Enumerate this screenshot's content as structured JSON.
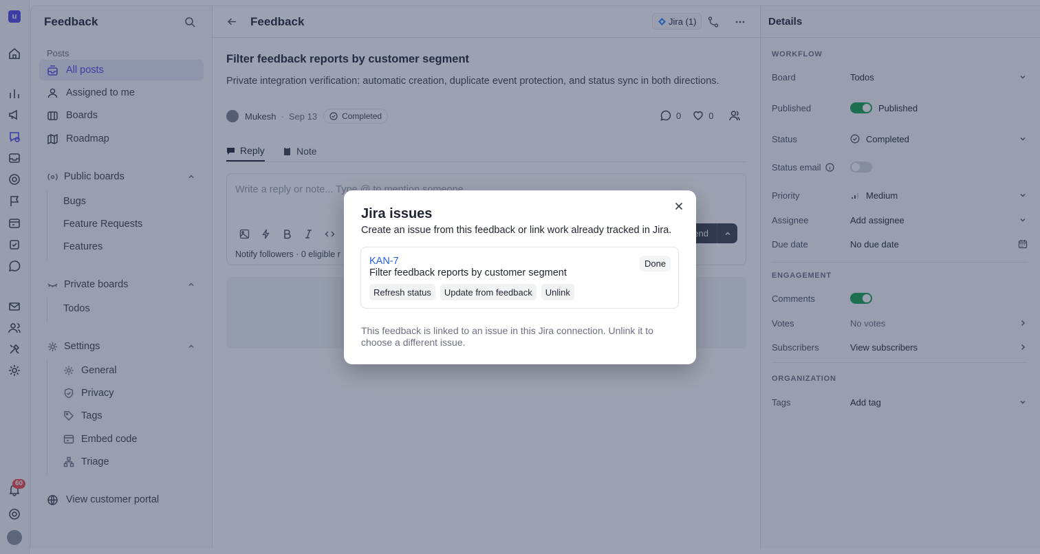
{
  "rail": {
    "logo_letter": "u",
    "notification_count": "60"
  },
  "sidebar": {
    "title": "Feedback",
    "posts_label": "Posts",
    "nav": [
      {
        "label": "All posts"
      },
      {
        "label": "Assigned to me"
      },
      {
        "label": "Boards"
      },
      {
        "label": "Roadmap"
      }
    ],
    "public_boards": {
      "label": "Public boards",
      "items": [
        "Bugs",
        "Feature Requests",
        "Features"
      ]
    },
    "private_boards": {
      "label": "Private boards",
      "items": [
        "Todos"
      ]
    },
    "settings": {
      "label": "Settings",
      "items": [
        "General",
        "Privacy",
        "Tags",
        "Embed code",
        "Triage"
      ]
    },
    "portal_link": "View customer portal"
  },
  "main": {
    "title": "Feedback",
    "jira_chip": "Jira (1)",
    "post_title": "Filter feedback reports by customer segment",
    "post_description": "Private integration verification: automatic creation, duplicate event protection, and status sync in both directions.",
    "author": "Mukesh",
    "date": "Sep 13",
    "status": "Completed",
    "comment_count": "0",
    "vote_count": "0",
    "tabs": [
      {
        "label": "Reply"
      },
      {
        "label": "Note"
      }
    ],
    "editor_placeholder": "Write a reply or note... Type @ to mention someone",
    "notify_text": "Notify followers · 0 eligible r",
    "send_label": "end"
  },
  "details": {
    "title": "Details",
    "workflow_label": "WORKFLOW",
    "engagement_label": "ENGAGEMENT",
    "organization_label": "ORGANIZATION",
    "board": {
      "label": "Board",
      "value": "Todos"
    },
    "published": {
      "label": "Published",
      "value": "Published"
    },
    "status": {
      "label": "Status",
      "value": "Completed"
    },
    "status_email": {
      "label": "Status email"
    },
    "priority": {
      "label": "Priority",
      "value": "Medium"
    },
    "assignee": {
      "label": "Assignee",
      "value": "Add assignee"
    },
    "due_date": {
      "label": "Due date",
      "value": "No due date"
    },
    "comments": {
      "label": "Comments"
    },
    "votes": {
      "label": "Votes",
      "value": "No votes"
    },
    "subscribers": {
      "label": "Subscribers",
      "value": "View subscribers"
    },
    "tags": {
      "label": "Tags",
      "value": "Add tag"
    }
  },
  "modal": {
    "title": "Jira issues",
    "subtitle": "Create an issue from this feedback or link work already tracked in Jira.",
    "issue": {
      "key": "KAN-7",
      "title": "Filter feedback reports by customer segment",
      "status": "Done",
      "actions": [
        "Refresh status",
        "Update from feedback",
        "Unlink"
      ]
    },
    "note": "This feedback is linked to an issue in this Jira connection. Unlink it to choose a different issue."
  },
  "colors": {
    "accent": "#4f46e5",
    "link": "#2563eb",
    "toggle_on": "#16a34a",
    "badge": "#ef4444"
  }
}
